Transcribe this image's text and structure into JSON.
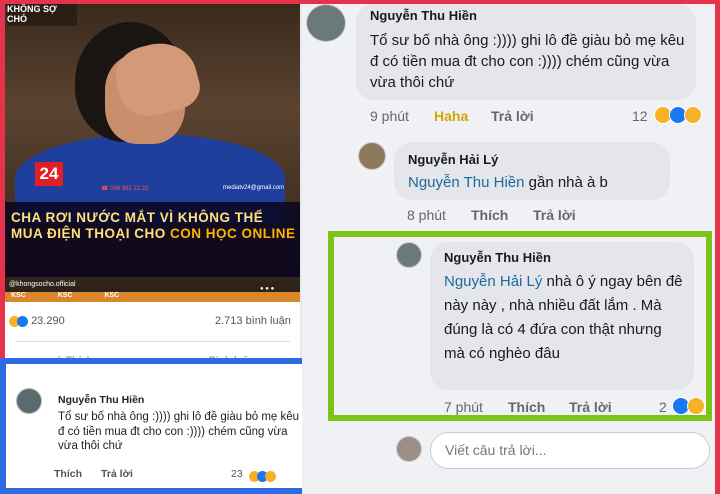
{
  "left_post": {
    "video": {
      "channel_logo": "KHÔNG SỢ CHÓ",
      "network_badge": "24",
      "phone": "☎ 096 382 22 22",
      "site": "mediatv24@gmail.com",
      "caption_part1": "CHA RƠI NƯỚC MẮT VÌ KHÔNG THỂ MUA ĐIỆN THOẠI CHO ",
      "caption_highlight": "CON HỌC ONLINE",
      "handle": "@khongsocho.official",
      "ticker": "KSC KSC KSC"
    },
    "reactions_count": "23.290",
    "comments_count": "2.713 bình luận",
    "action_like": "Thích",
    "action_comment": "Bình luận"
  },
  "quoted_comment": {
    "name": "Nguyễn Thu Hiền",
    "text": "Tổ sư bố nhà ông :)))) ghi lô đề giàu bỏ mẹ kêu đ có tiền mua đt cho con :)))) chém cũng vừa vừa thôi chứ",
    "like": "Thích",
    "reply": "Trả lời",
    "reaction_count": "23"
  },
  "thread": {
    "comment1": {
      "name": "Nguyễn Thu Hiền",
      "text": "Tổ sư bố nhà ông :)))) ghi lô đề giàu bỏ mẹ kêu đ có tiền mua đt cho con :)))) chém cũng vừa vừa thôi chứ",
      "time": "9 phút",
      "reaction_label": "Haha",
      "reply": "Trả lời",
      "reaction_count": "12"
    },
    "reply1": {
      "name": "Nguyễn Hải Lý",
      "mention": "Nguyễn Thu Hiền",
      "text": " gần nhà à b",
      "time": "8 phút",
      "like": "Thích",
      "reply": "Trả lời"
    },
    "reply2": {
      "name": "Nguyễn Thu Hiền",
      "mention": "Nguyễn Hải Lý",
      "text": "  nhà ô ý ngay bên đê này này , nhà nhiều đất lắm . Mà đúng là có 4 đứa con thật nhưng mà có nghèo đâu",
      "time": "7 phút",
      "like": "Thích",
      "reply": "Trả lời",
      "reaction_count": "2"
    },
    "reply_input_placeholder": "Viết câu trả lời..."
  },
  "colors": {
    "frame_red": "#e4334a",
    "blue_highlight": "#2e6be0",
    "green_highlight": "#7cc418",
    "mention_blue": "#1a6b9b"
  }
}
